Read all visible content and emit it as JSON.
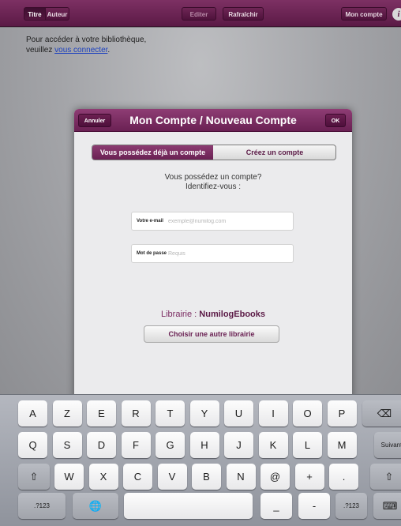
{
  "toolbar": {
    "sort_titre": "Titre",
    "sort_auteur": "Auteur",
    "edit_label": "Editer",
    "refresh_label": "Rafraîchir",
    "account_label": "Mon compte",
    "info_glyph": "i"
  },
  "library": {
    "message_line1": "Pour accéder à votre bibliothèque,",
    "message_line2_prefix": "veuillez ",
    "login_link": "vous connecter",
    "message_suffix": "."
  },
  "modal": {
    "title": "Mon Compte / Nouveau Compte",
    "cancel_label": "Annuler",
    "ok_label": "OK",
    "tab_existing": "Vous possédez déjà un compte",
    "tab_create": "Créez un compte",
    "prompt_line1": "Vous possédez un compte?",
    "prompt_line2": "Identifiez-vous :",
    "email_label": "Votre e-mail",
    "email_placeholder": "exemple@numilog.com",
    "email_value": "",
    "password_label": "Mot de passe",
    "password_placeholder": "Requis",
    "password_value": "",
    "library_prefix": "Librairie : ",
    "library_name": "NumilogEbooks",
    "choose_library_label": "Choisir une autre librairie"
  },
  "keyboard": {
    "row1": [
      "A",
      "Z",
      "E",
      "R",
      "T",
      "Y",
      "U",
      "I",
      "O",
      "P"
    ],
    "row2": [
      "Q",
      "S",
      "D",
      "F",
      "G",
      "H",
      "J",
      "K",
      "L",
      "M"
    ],
    "row3": [
      "W",
      "X",
      "C",
      "V",
      "B",
      "N",
      "@",
      "+",
      "."
    ],
    "backspace_glyph": "⌫",
    "return_label": "Suivant",
    "shift_glyph": "⇧",
    "numbers_label": ".?123",
    "globe_glyph": "🌐",
    "underscore_glyph": "_",
    "dash_glyph": "-",
    "hide_keyboard_glyph": "⌨"
  }
}
